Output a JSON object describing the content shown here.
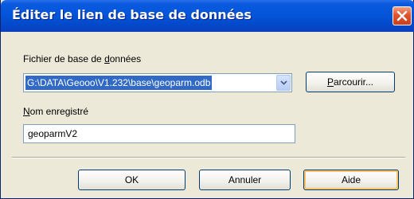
{
  "window": {
    "title": "Éditer le lien de base de données",
    "close_icon": "close-icon"
  },
  "db_file": {
    "label_prefix": "Fichier de base de ",
    "label_accel": "d",
    "label_suffix": "onnées",
    "value": "G:\\DATA\\Geooo\\V1.232\\base\\geoparm.odb",
    "dropdown_icon": "chevron-down-icon"
  },
  "browse_button": {
    "accel": "P",
    "rest": "arcourir..."
  },
  "saved_name": {
    "label_accel": "N",
    "label_rest": "om enregistré",
    "value": "geoparmV2"
  },
  "buttons": {
    "ok": "OK",
    "cancel": "Annuler",
    "help": "Aide"
  },
  "colors": {
    "titlebar": "#0455d9",
    "selection": "#316ac5",
    "close": "#e0532f",
    "dialog_bg": "#ece9d8"
  }
}
